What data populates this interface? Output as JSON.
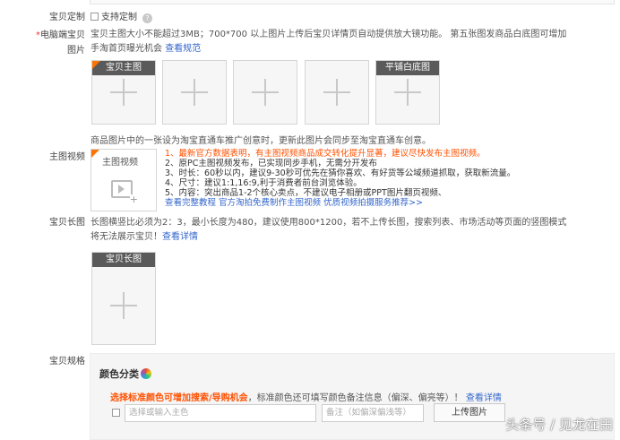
{
  "customization": {
    "label": "宝贝定制",
    "checkbox_label": "支持定制",
    "help_icon": "question-icon"
  },
  "pc_images": {
    "required_mark": "*",
    "label_line1": "电脑端宝贝",
    "label_line2": "图片",
    "desc_line1": "宝贝主图大小不能超过3MB；700*700 以上图片上传后宝贝详情页自动提供放大镜功能。 第五张图发商品白底图可增加",
    "desc_line2": "手淘首页曝光机会",
    "desc_link": "查看规范",
    "slots": [
      {
        "tag": "宝贝主图"
      },
      {
        "tag": ""
      },
      {
        "tag": ""
      },
      {
        "tag": ""
      },
      {
        "tag": "平铺白底图"
      }
    ],
    "footer_note": "商品图片中的一张设为淘宝直通车推广创意时，更新此图片会同步至淘宝直通车创意。"
  },
  "main_video": {
    "label": "主图视频",
    "box_label": "主图视频",
    "tip1": "1、最新官方数据表明，有主图视频商品成交转化提升显著，建议尽快发布主图视频。",
    "tip2": "2、原PC主图视频发布，已实现同步手机，无需分开发布",
    "tip3": "3、时长：60秒以内，建议9-30秒可优先在猜你喜欢、有好货等公域频道抓取，获取新流量。",
    "tip4": "4、尺寸：建议1:1,16:9,利于消费者前台浏览体验。",
    "tip5": "5、内容：突出商品1-2个核心卖点，不建议电子相册或PPT图片翻页视频、",
    "link1": "查看完整教程",
    "link2": "官方淘拍免费制作主图视频",
    "link3": "优质视频拍摄服务推荐>>"
  },
  "long_image": {
    "label": "宝贝长图",
    "desc_line1": "长图横竖比必须为2：3，最小长度为480，建议使用800*1200，若不上传长图，搜索列表、市场活动等页面的竖图模式",
    "desc_line2": "将无法展示宝贝！",
    "desc_link": "查看详情",
    "box_tag": "宝贝长图"
  },
  "spec": {
    "label": "宝贝规格",
    "color_title": "颜色分类",
    "warn_text": "选择标准颜色可增加搜索/导购机会",
    "note_text": "，标准颜色还可填写颜色备注信息（偏深、偏亮等）！",
    "note_link": "查看详情",
    "color_placeholder": "选择或输入主色",
    "remark_placeholder": "备注（如偏深偏浅等）",
    "upload_button": "上传图片"
  },
  "watermark": "头条号 / 见龙在田"
}
